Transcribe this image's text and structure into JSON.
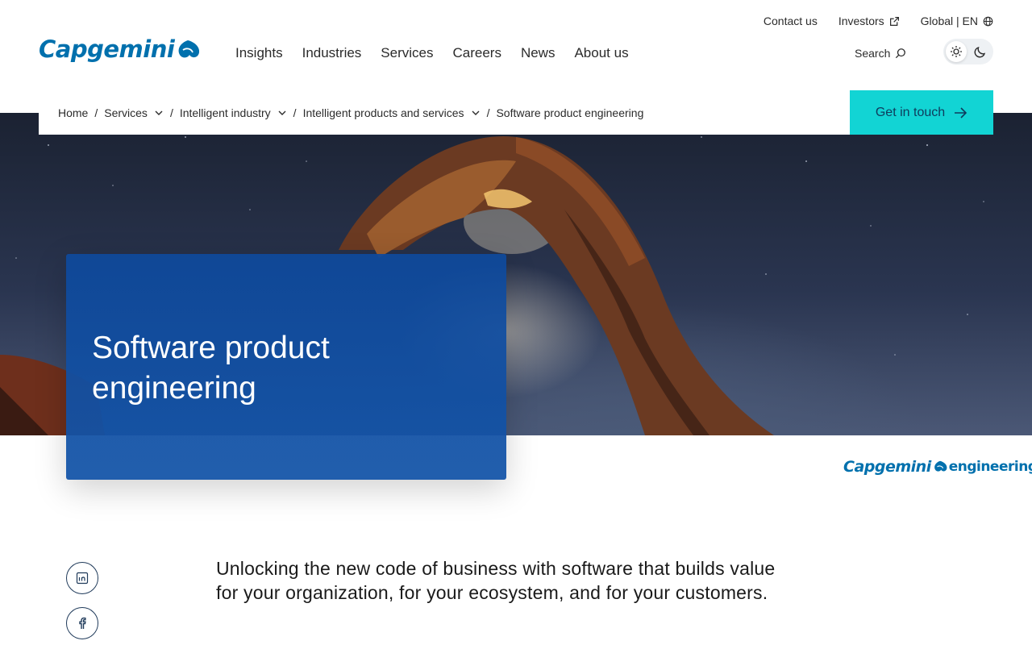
{
  "brand": {
    "name": "Capgemini",
    "accent_color": "#0070ad",
    "cta_color": "#12d4d4",
    "card_color": "#0e499c"
  },
  "utility_nav": {
    "contact": "Contact us",
    "investors": "Investors",
    "region": "Global | EN"
  },
  "main_nav": {
    "items": [
      "Insights",
      "Industries",
      "Services",
      "Careers",
      "News",
      "About us"
    ]
  },
  "search": {
    "label": "Search"
  },
  "theme": {
    "active": "light"
  },
  "breadcrumb": {
    "items": [
      {
        "label": "Home",
        "has_dropdown": false
      },
      {
        "label": "Services",
        "has_dropdown": true
      },
      {
        "label": "Intelligent industry",
        "has_dropdown": true
      },
      {
        "label": "Intelligent products and services",
        "has_dropdown": true
      },
      {
        "label": "Software product engineering",
        "has_dropdown": false
      }
    ]
  },
  "cta": {
    "label": "Get in touch"
  },
  "hero": {
    "title": "Software product engineering"
  },
  "sub_brand": {
    "primary": "Capgemini",
    "secondary": "engineering"
  },
  "social": {
    "icons": [
      "linkedin-icon",
      "facebook-icon"
    ]
  },
  "intro": {
    "text": "Unlocking the new code of business with software that builds value for your organization, for your ecosystem, and for your customers."
  }
}
